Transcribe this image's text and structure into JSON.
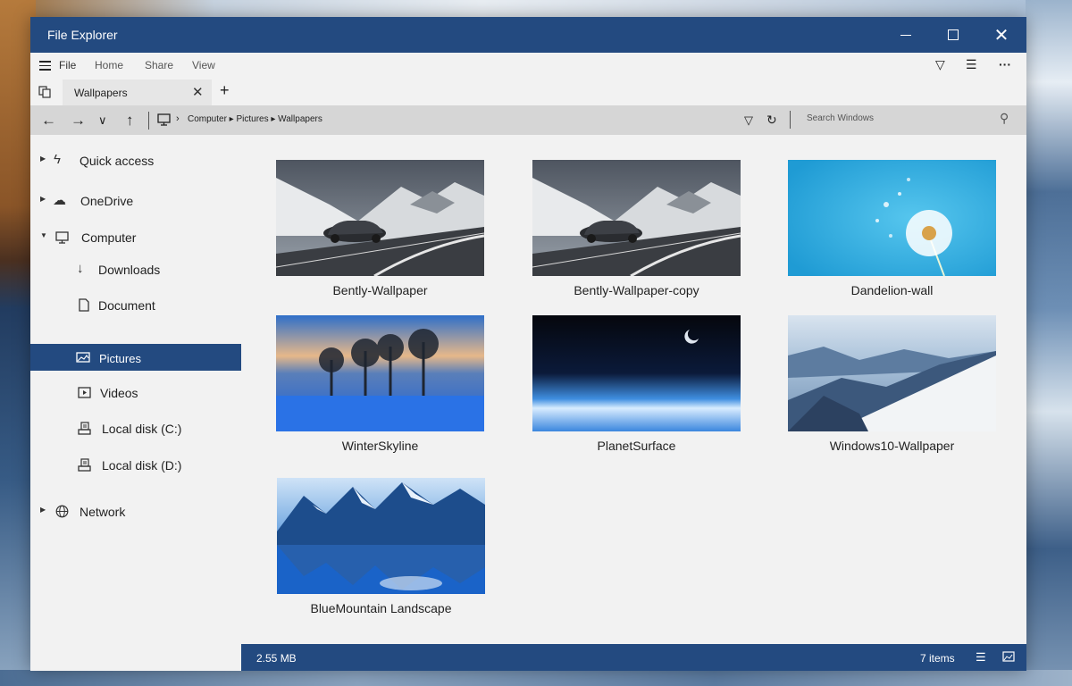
{
  "window": {
    "title": "File Explorer",
    "accent_color": "#234a80"
  },
  "menu": {
    "file": "File",
    "home": "Home",
    "share": "Share",
    "view": "View"
  },
  "tab": {
    "label": "Wallpapers"
  },
  "address": {
    "path": "Computer ▸ Pictures ▸ Wallpapers",
    "search_placeholder": "Search Windows"
  },
  "sidebar": {
    "items": [
      {
        "label": "Quick access",
        "icon": "lightning-icon"
      },
      {
        "label": "OneDrive",
        "icon": "cloud-icon"
      },
      {
        "label": "Computer",
        "icon": "monitor-icon"
      },
      {
        "label": "Downloads",
        "icon": "download-arrow-icon"
      },
      {
        "label": "Document",
        "icon": "document-icon"
      },
      {
        "label": "Pictures",
        "icon": "picture-icon"
      },
      {
        "label": "Videos",
        "icon": "video-icon"
      },
      {
        "label": "Local disk (C:)",
        "icon": "drive-icon"
      },
      {
        "label": "Local disk (D:)",
        "icon": "drive-icon"
      },
      {
        "label": "Network",
        "icon": "globe-icon"
      }
    ]
  },
  "files": [
    {
      "name": "Bently-Wallpaper"
    },
    {
      "name": "Bently-Wallpaper-copy"
    },
    {
      "name": "Dandelion-wall"
    },
    {
      "name": "WinterSkyline"
    },
    {
      "name": "PlanetSurface"
    },
    {
      "name": "Windows10-Wallpaper"
    },
    {
      "name": "BlueMountain Landscape"
    }
  ],
  "status": {
    "size": "2.55 MB",
    "count": "7 items"
  }
}
